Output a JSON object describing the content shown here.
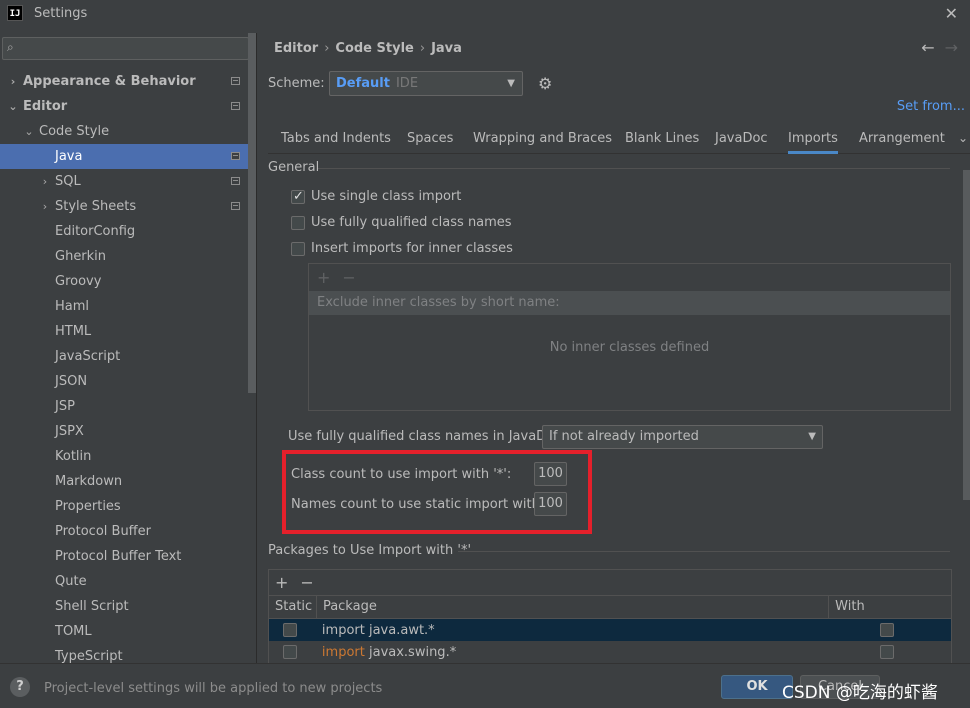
{
  "window": {
    "title": "Settings",
    "app_icon": "IJ"
  },
  "sidebar": {
    "tree": [
      {
        "label": "Appearance & Behavior",
        "level": 0,
        "arrow": "›",
        "bold": true,
        "badge": true
      },
      {
        "label": "Editor",
        "level": 0,
        "arrow": "⌄",
        "bold": true,
        "badge": true
      },
      {
        "label": "Code Style",
        "level": 1,
        "arrow": "⌄"
      },
      {
        "label": "Java",
        "level": 2,
        "selected": true,
        "badge": true
      },
      {
        "label": "SQL",
        "level": 2,
        "arrow": "›",
        "badge": true
      },
      {
        "label": "Style Sheets",
        "level": 2,
        "arrow": "›",
        "badge": true
      },
      {
        "label": "EditorConfig",
        "level": 2
      },
      {
        "label": "Gherkin",
        "level": 2
      },
      {
        "label": "Groovy",
        "level": 2
      },
      {
        "label": "Haml",
        "level": 2
      },
      {
        "label": "HTML",
        "level": 2
      },
      {
        "label": "JavaScript",
        "level": 2
      },
      {
        "label": "JSON",
        "level": 2
      },
      {
        "label": "JSP",
        "level": 2
      },
      {
        "label": "JSPX",
        "level": 2
      },
      {
        "label": "Kotlin",
        "level": 2
      },
      {
        "label": "Markdown",
        "level": 2
      },
      {
        "label": "Properties",
        "level": 2
      },
      {
        "label": "Protocol Buffer",
        "level": 2
      },
      {
        "label": "Protocol Buffer Text",
        "level": 2
      },
      {
        "label": "Qute",
        "level": 2
      },
      {
        "label": "Shell Script",
        "level": 2
      },
      {
        "label": "TOML",
        "level": 2
      },
      {
        "label": "TypeScript",
        "level": 2
      }
    ]
  },
  "header": {
    "breadcrumb": [
      "Editor",
      "Code Style",
      "Java"
    ],
    "scheme_label": "Scheme:",
    "scheme_name": "Default",
    "scheme_type": "IDE",
    "set_from": "Set from..."
  },
  "tabs": [
    {
      "label": "Tabs and Indents"
    },
    {
      "label": "Spaces"
    },
    {
      "label": "Wrapping and Braces"
    },
    {
      "label": "Blank Lines"
    },
    {
      "label": "JavaDoc"
    },
    {
      "label": "Imports",
      "active": true
    },
    {
      "label": "Arrangement"
    }
  ],
  "general": {
    "title": "General",
    "options": [
      {
        "label": "Use single class import",
        "checked": true
      },
      {
        "label": "Use fully qualified class names",
        "checked": false
      },
      {
        "label": "Insert imports for inner classes",
        "checked": false
      }
    ],
    "inner_header": "Exclude inner classes by short name:",
    "inner_empty": "No inner classes defined",
    "javadoc_label": "Use fully qualified class names in JavaDoc:",
    "javadoc_value": "If not already imported",
    "class_count_label": "Class count to use import with '*':",
    "class_count_value": "100",
    "names_count_label": "Names count to use static import with '*':",
    "names_count_value": "100"
  },
  "packages": {
    "title": "Packages to Use Import with '*'",
    "columns": [
      "Static",
      "Package",
      "With Subpackages"
    ],
    "rows": [
      {
        "keyword": "",
        "package": "import java.awt.*",
        "static": false,
        "sub": false,
        "selected": true
      },
      {
        "keyword": "import",
        "package": " javax.swing.*",
        "static": false,
        "sub": false,
        "selected": false
      }
    ]
  },
  "footer": {
    "help": "?",
    "note": "Project-level settings will be applied to new projects",
    "ok": "OK",
    "cancel": "Cancel",
    "watermark": "CSDN @吃海的虾酱"
  }
}
